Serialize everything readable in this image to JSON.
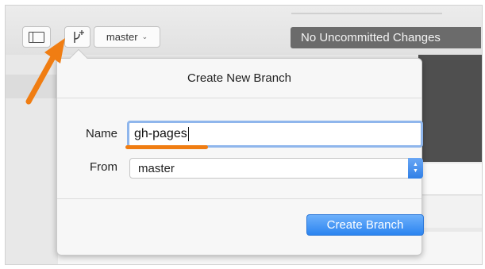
{
  "toolbar": {
    "branch_select_value": "master",
    "status": "No Uncommitted Changes",
    "icons": {
      "sidebar": "sidebar-toggle-icon",
      "new_branch": "new-branch-icon",
      "dropdown": "chevron-down-icon"
    }
  },
  "dialog": {
    "title": "Create New Branch",
    "name_label": "Name",
    "name_value": "gh-pages",
    "from_label": "From",
    "from_value": "master",
    "submit_label": "Create Branch"
  },
  "colors": {
    "accent_blue": "#2b84f0",
    "annotation_orange": "#f07d12",
    "status_bg": "#6b6b6b"
  }
}
